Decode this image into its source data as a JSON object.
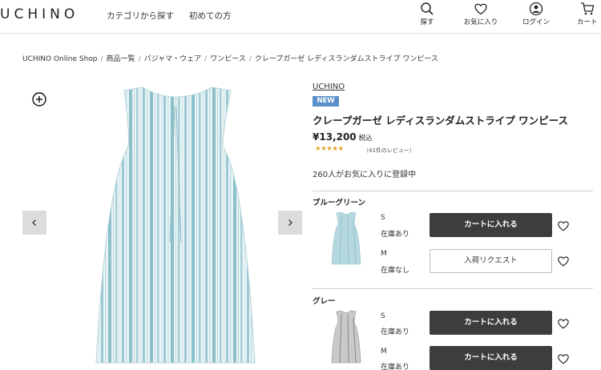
{
  "header": {
    "logo": "UCHINO",
    "nav": [
      "カテゴリから探す",
      "初めての方"
    ],
    "icons": [
      {
        "name": "search-icon",
        "label": "探す"
      },
      {
        "name": "heart-icon",
        "label": "お気に入り"
      },
      {
        "name": "user-icon",
        "label": "ログイン"
      },
      {
        "name": "cart-icon",
        "label": "カート"
      }
    ]
  },
  "breadcrumb": [
    "UCHINO Online Shop",
    "商品一覧",
    "パジャマ・ウェア",
    "ワンピース",
    "クレープガーゼ レディスランダムストライプ ワンピース"
  ],
  "product": {
    "brand": "UCHINO",
    "badge": "NEW",
    "title": "クレープガーゼ レディスランダムストライプ ワンピース",
    "price": "¥13,200",
    "tax": "税込",
    "rating": 4.5,
    "stars": "★★★★★",
    "reviews": "（41件のレビュー）",
    "fav_count": "260人がお気に入りに登録中"
  },
  "variants": [
    {
      "color": "ブルーグリーン",
      "swatch": "#a9cfd6",
      "sizes": [
        {
          "size": "S",
          "stock": "在庫あり",
          "button": "カートに入れる",
          "button_type": "cart"
        },
        {
          "size": "M",
          "stock": "在庫なし",
          "button": "入荷リクエスト",
          "button_type": "request"
        }
      ]
    },
    {
      "color": "グレー",
      "swatch": "#9a9a9a",
      "sizes": [
        {
          "size": "S",
          "stock": "在庫あり",
          "button": "カートに入れる",
          "button_type": "cart"
        },
        {
          "size": "M",
          "stock": "在庫あり",
          "button": "カートに入れる",
          "button_type": "cart"
        }
      ]
    }
  ],
  "gallery": {
    "zoom_icon": "zoom-plus-icon",
    "prev_icon": "chevron-left-icon",
    "next_icon": "chevron-right-icon"
  }
}
